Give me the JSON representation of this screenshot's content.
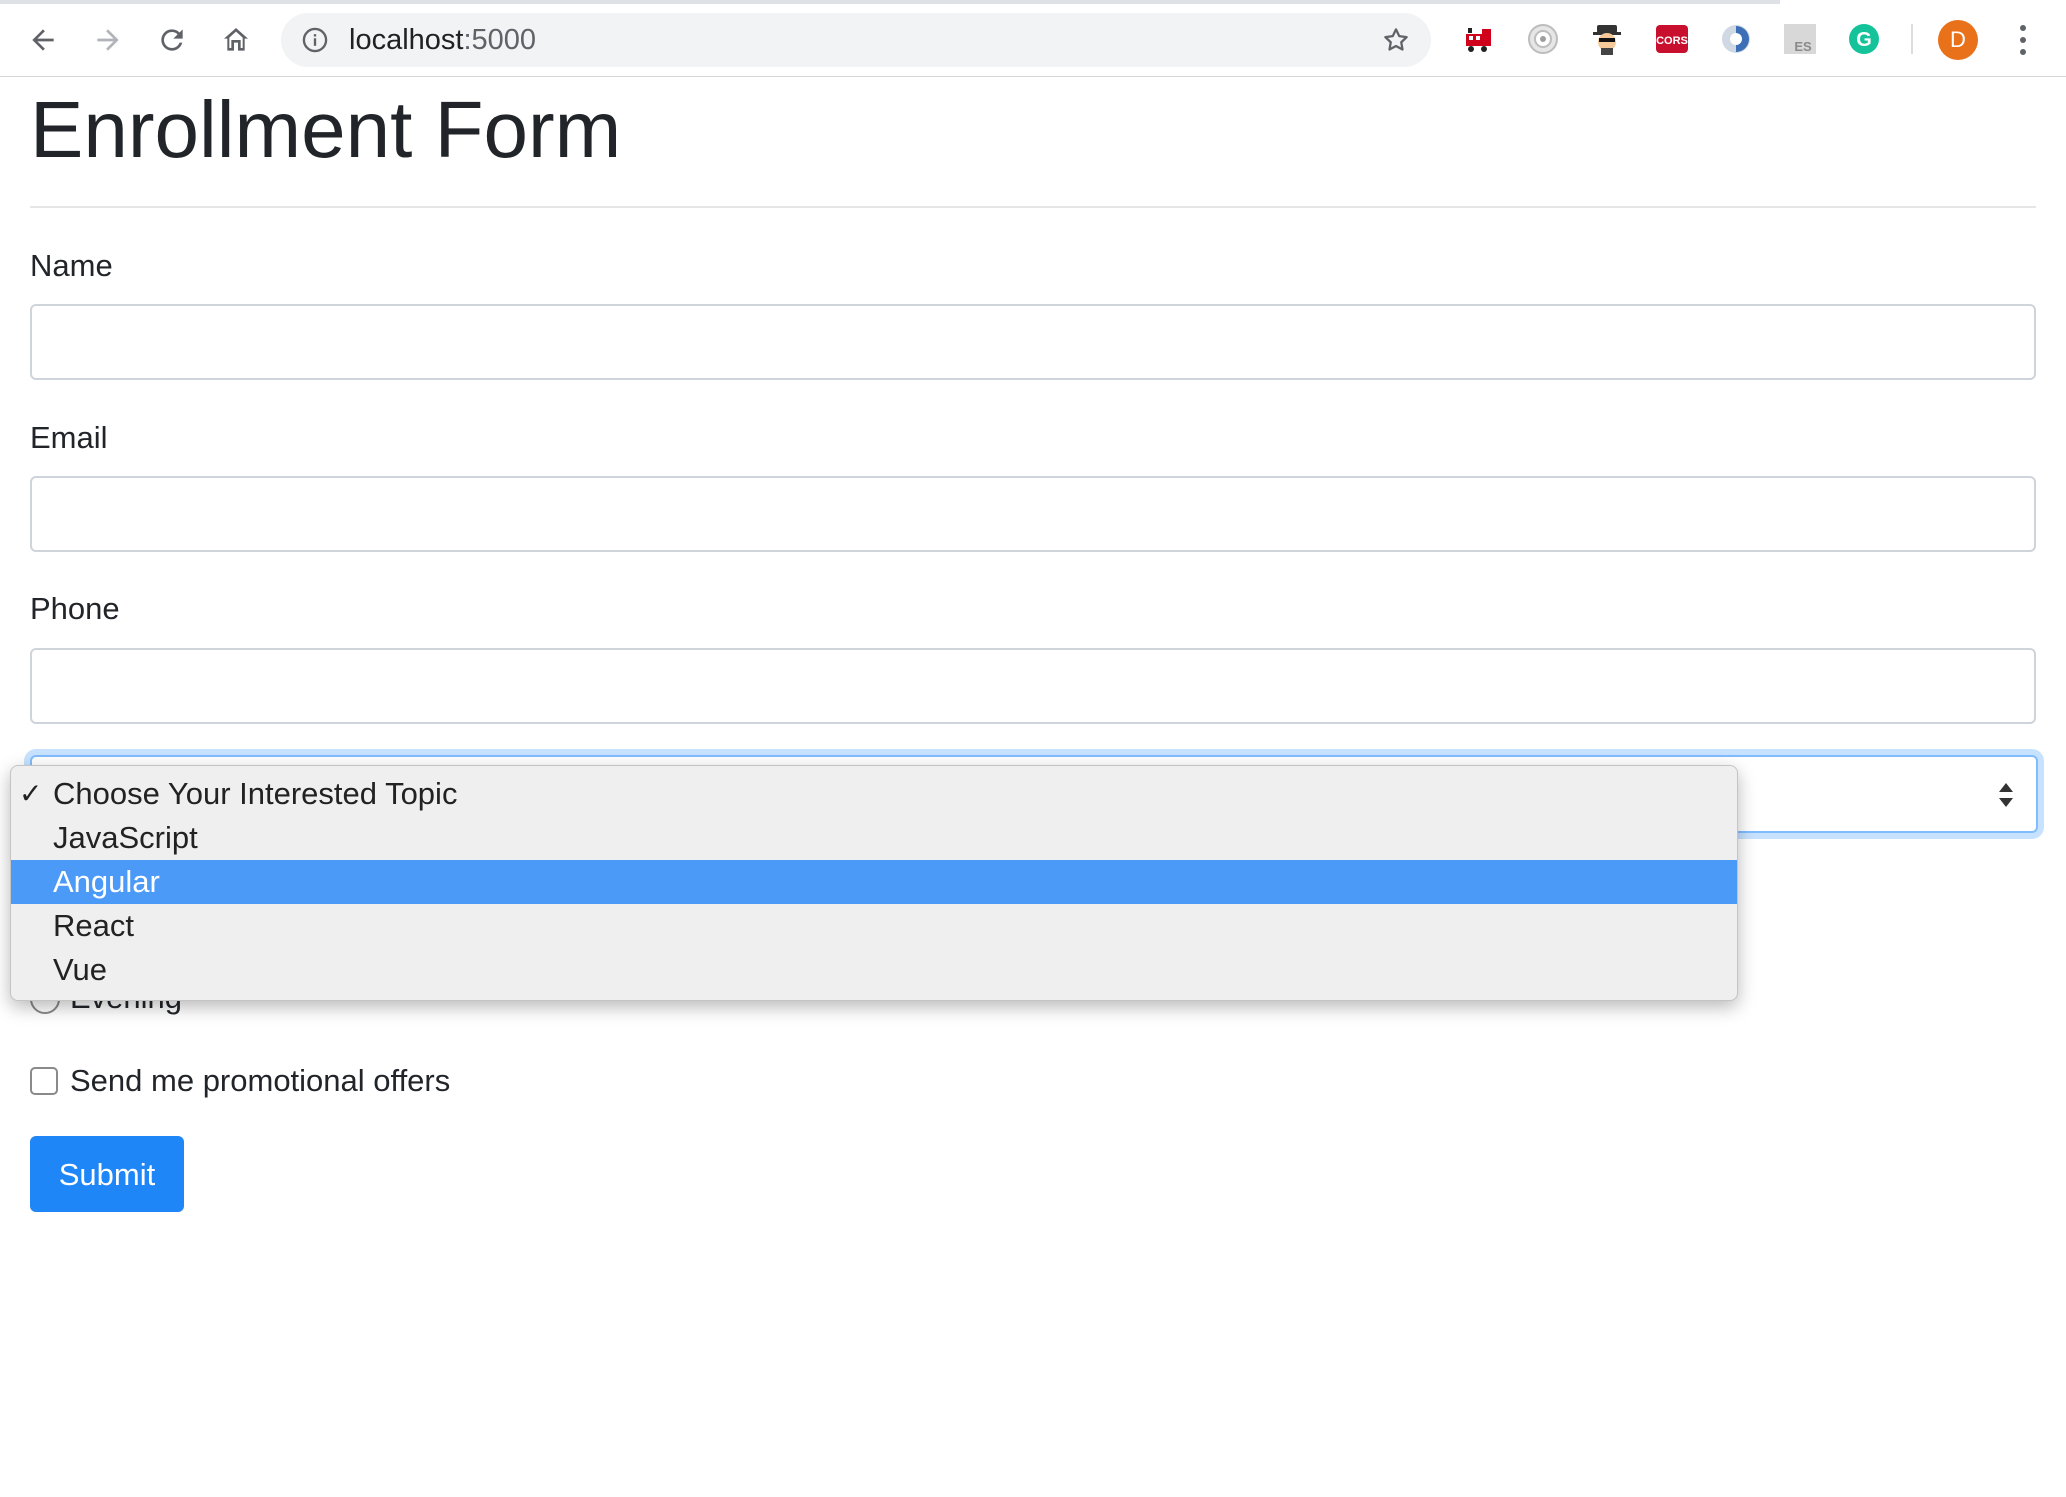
{
  "browser": {
    "url_host": "localhost",
    "url_port": ":5000",
    "profile_initial": "D",
    "extensions": [
      "train-extension-icon",
      "target-extension-icon",
      "spy-extension-icon",
      "cors-extension-icon",
      "shield-extension-icon",
      "es-extension-icon",
      "grammarly-extension-icon"
    ],
    "extension_texts": {
      "cors": "CORS",
      "es": "ES",
      "grammarly": "G"
    }
  },
  "page": {
    "title": "Enrollment Form"
  },
  "form": {
    "name_label": "Name",
    "name_value": "",
    "email_label": "Email",
    "email_value": "",
    "phone_label": "Phone",
    "phone_value": "",
    "topic_select": {
      "selected": "Choose Your Interested Topic",
      "highlighted": "Angular",
      "options": [
        "Choose Your Interested Topic",
        "JavaScript",
        "Angular",
        "React",
        "Vue"
      ]
    },
    "radio_visible_label": "Evening",
    "promo_checkbox_label": "Send me promotional offers",
    "promo_checked": false,
    "submit_label": "Submit"
  },
  "colors": {
    "primary": "#1e86f7",
    "highlight": "#4b9af8",
    "focus_border": "#80bdff",
    "avatar": "#e8711a"
  }
}
